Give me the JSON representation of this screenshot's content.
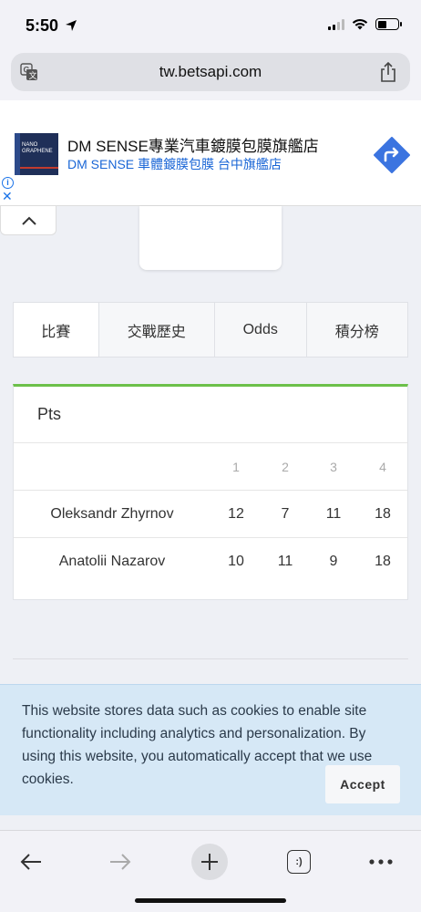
{
  "status_bar": {
    "time": "5:50",
    "battery_level": 0.45
  },
  "browser": {
    "url": "tw.betsapi.com"
  },
  "ad": {
    "logo_text": "NANO GRAPHENE",
    "title": "DM SENSE專業汽車鍍膜包膜旗艦店",
    "subtitle": "DM SENSE 車體鍍膜包膜 台中旗艦店",
    "close_label": "✕"
  },
  "tabs": [
    {
      "label": "比賽",
      "active": true
    },
    {
      "label": "交戰歷史",
      "active": false
    },
    {
      "label": "Odds",
      "active": false
    },
    {
      "label": "積分榜",
      "active": false
    }
  ],
  "pts_table": {
    "title": "Pts",
    "columns": [
      "1",
      "2",
      "3",
      "4"
    ],
    "rows": [
      {
        "name": "Oleksandr Zhyrnov",
        "values": [
          "12",
          "7",
          "11",
          "18"
        ]
      },
      {
        "name": "Anatolii Nazarov",
        "values": [
          "10",
          "11",
          "9",
          "18"
        ]
      }
    ]
  },
  "cookie_banner": {
    "text": "This website stores data such as cookies to enable site functionality including analytics and personalization. By using this website, you automatically accept that we use cookies.",
    "accept_label": "Accept"
  },
  "toolbar": {
    "tabs_icon_label": ":)"
  },
  "colors": {
    "accent_green": "#6cc04a",
    "link_blue": "#1a66d6",
    "cookie_bg": "#d6e8f6"
  }
}
